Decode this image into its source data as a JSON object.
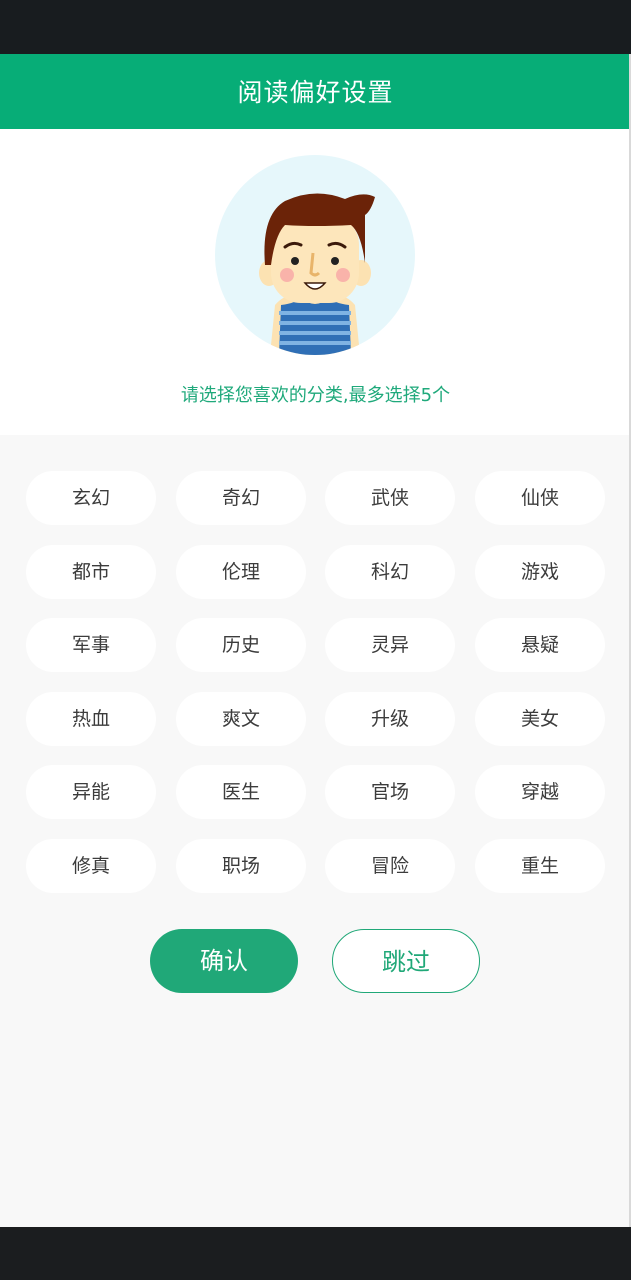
{
  "header": {
    "title": "阅读偏好设置"
  },
  "hero": {
    "hint": "请选择您喜欢的分类,最多选择5个"
  },
  "categories": [
    "玄幻",
    "奇幻",
    "武侠",
    "仙侠",
    "都市",
    "伦理",
    "科幻",
    "游戏",
    "军事",
    "历史",
    "灵异",
    "悬疑",
    "热血",
    "爽文",
    "升级",
    "美女",
    "异能",
    "医生",
    "官场",
    "穿越",
    "修真",
    "职场",
    "冒险",
    "重生"
  ],
  "actions": {
    "confirm_label": "确认",
    "skip_label": "跳过"
  },
  "colors": {
    "brand": "#07ad77",
    "accent": "#20a878"
  }
}
